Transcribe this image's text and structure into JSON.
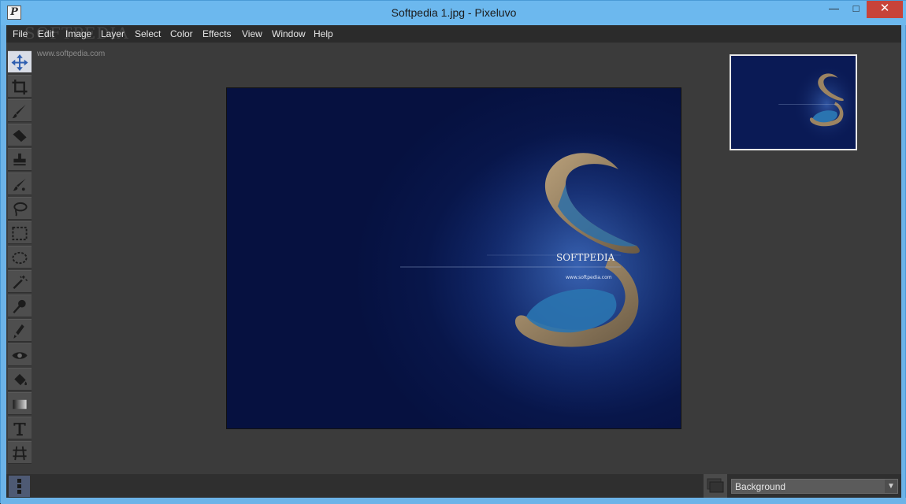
{
  "window": {
    "title": "Softpedia 1.jpg - Pixeluvo",
    "minimize_glyph": "—",
    "maximize_glyph": "□",
    "close_glyph": "✕",
    "accent": "#6cb8ee",
    "close_color": "#c7433a"
  },
  "menu": {
    "items": [
      "File",
      "Edit",
      "Image",
      "Layer",
      "Select",
      "Color",
      "Effects",
      "View",
      "Window",
      "Help"
    ]
  },
  "watermark": {
    "text": "SOFTPEDIA",
    "url": "www.softpedia.com"
  },
  "tools": [
    {
      "name": "move-tool",
      "icon": "move-icon",
      "active": true
    },
    {
      "name": "crop-tool",
      "icon": "crop-icon"
    },
    {
      "name": "brush-tool",
      "icon": "brush-icon"
    },
    {
      "name": "eraser-tool",
      "icon": "eraser-icon"
    },
    {
      "name": "clone-stamp-tool",
      "icon": "stamp-icon"
    },
    {
      "name": "healing-tool",
      "icon": "heal-brush-icon"
    },
    {
      "name": "lasso-tool",
      "icon": "lasso-icon"
    },
    {
      "name": "rect-select-tool",
      "icon": "rect-select-icon"
    },
    {
      "name": "ellipse-select-tool",
      "icon": "ellipse-select-icon"
    },
    {
      "name": "magic-wand-tool",
      "icon": "magic-wand-icon"
    },
    {
      "name": "dodge-tool",
      "icon": "dodge-icon"
    },
    {
      "name": "smudge-tool",
      "icon": "smudge-icon"
    },
    {
      "name": "red-eye-tool",
      "icon": "eye-icon"
    },
    {
      "name": "fill-tool",
      "icon": "bucket-icon"
    },
    {
      "name": "gradient-tool",
      "icon": "gradient-icon"
    },
    {
      "name": "text-tool",
      "icon": "text-icon"
    },
    {
      "name": "perspective-tool",
      "icon": "perspective-icon"
    }
  ],
  "canvas": {
    "brand_text": "SOFTPEDIA",
    "url_text": "www.softpedia.com"
  },
  "layers": {
    "selected": "Background"
  }
}
